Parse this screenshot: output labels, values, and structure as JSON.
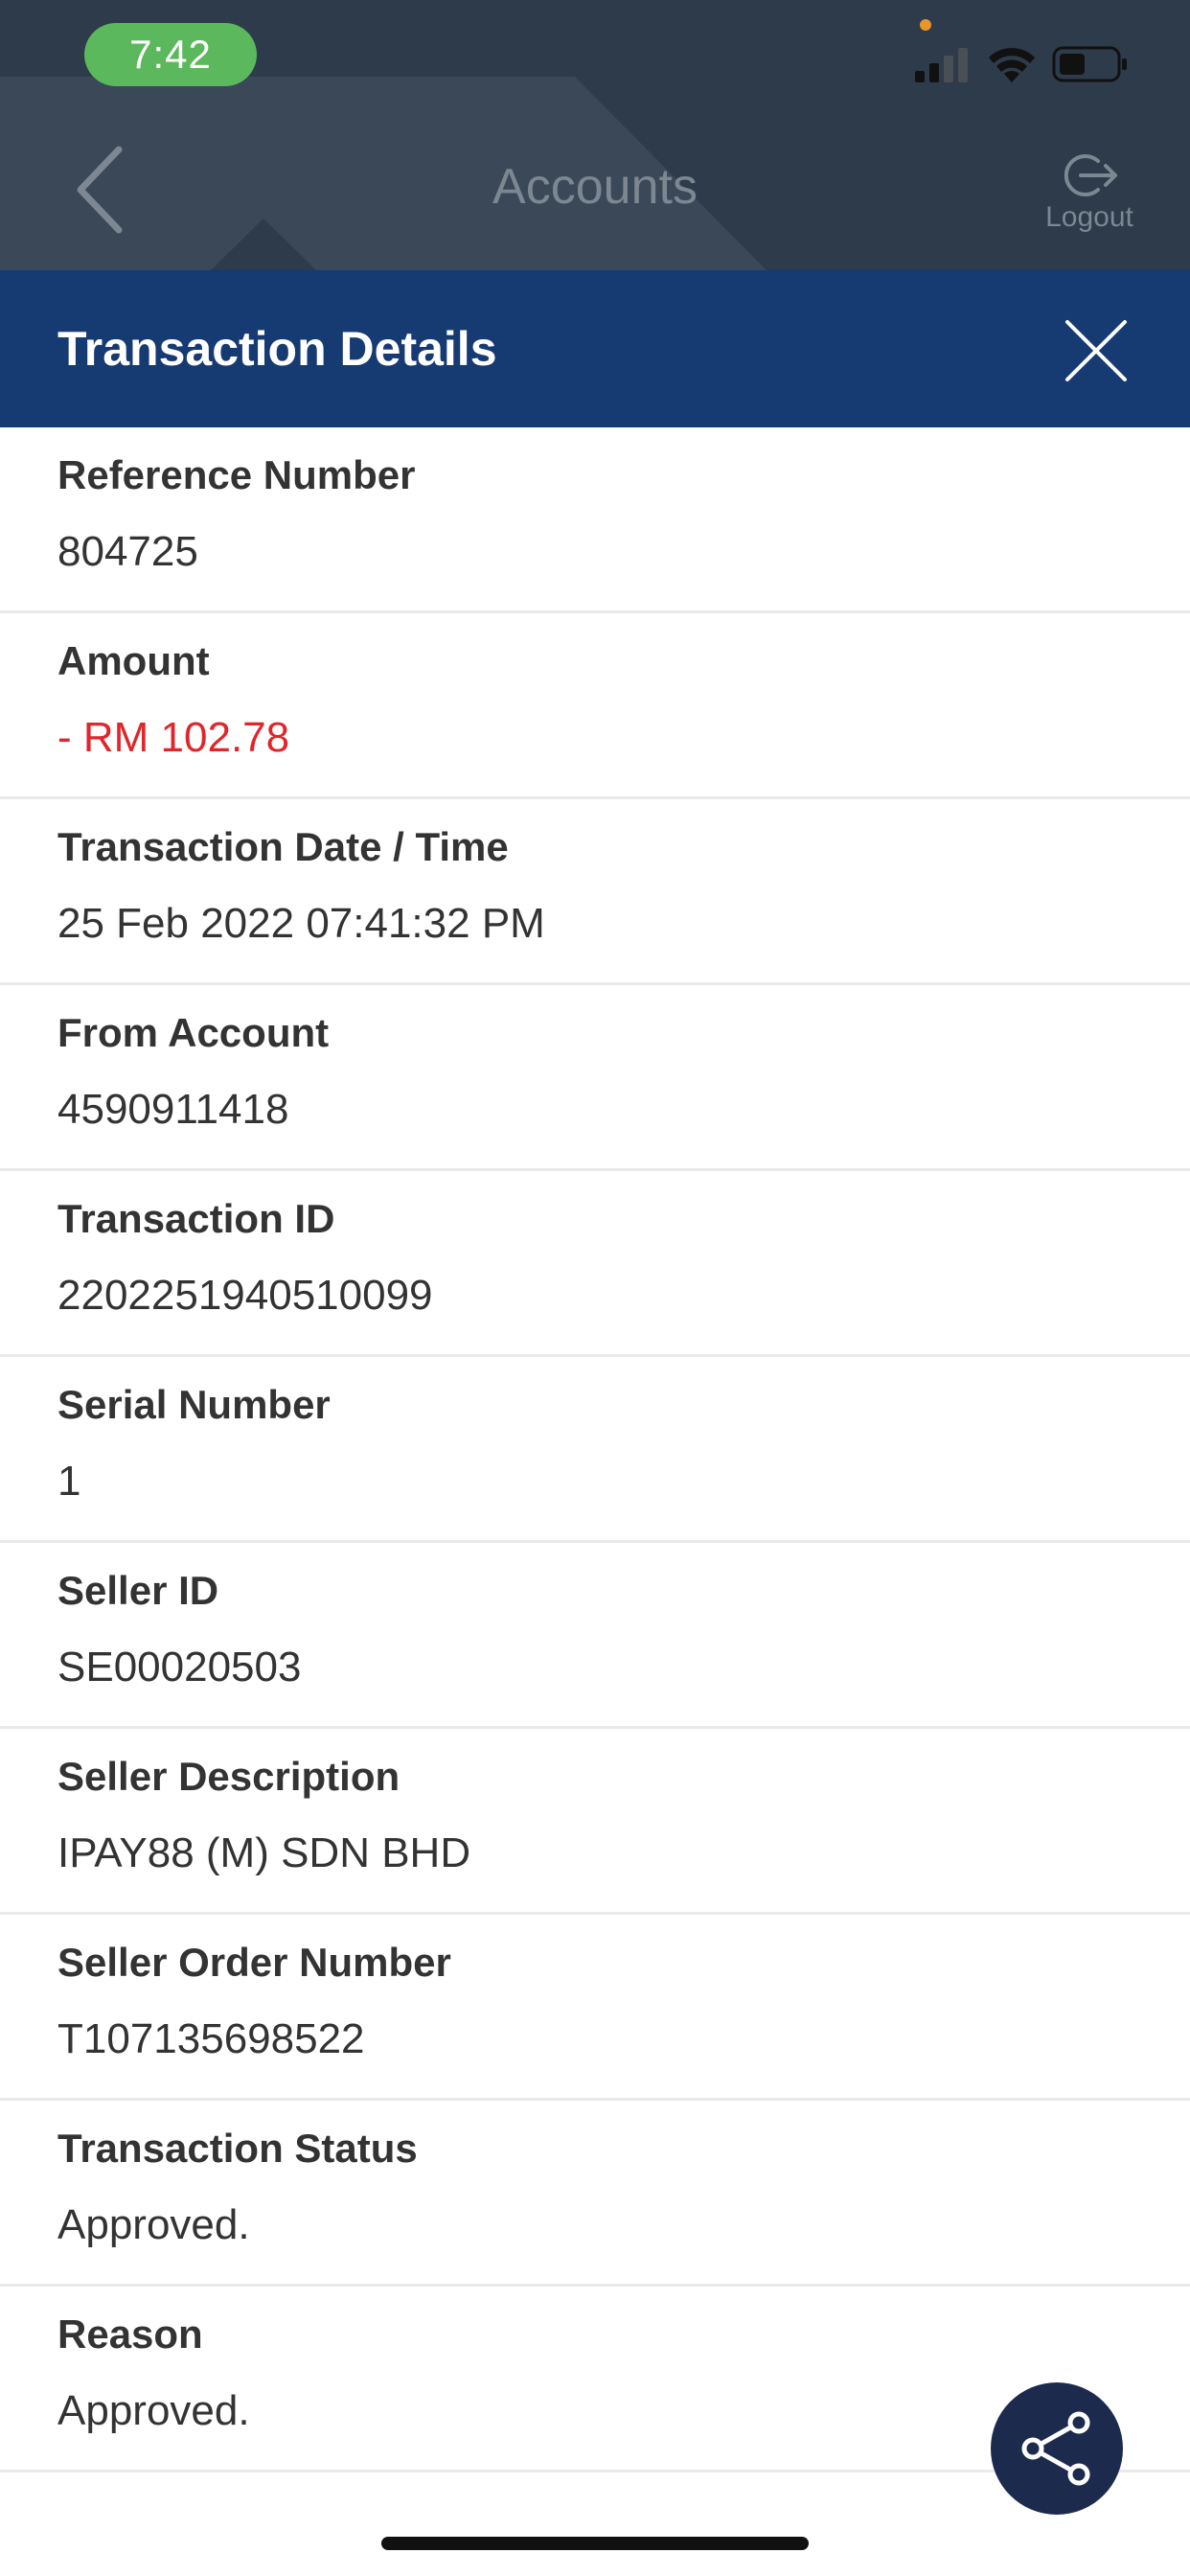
{
  "status_bar": {
    "time": "7:42"
  },
  "app_bar": {
    "title": "Accounts",
    "logout_label": "Logout"
  },
  "sheet": {
    "title": "Transaction Details",
    "rows": [
      {
        "label": "Reference Number",
        "value": "804725"
      },
      {
        "label": "Amount",
        "value": "- RM 102.78"
      },
      {
        "label": "Transaction Date / Time",
        "value": "25 Feb 2022 07:41:32 PM"
      },
      {
        "label": "From Account",
        "value": "4590911418"
      },
      {
        "label": "Transaction ID",
        "value": "2202251940510099"
      },
      {
        "label": "Serial Number",
        "value": "1"
      },
      {
        "label": "Seller ID",
        "value": "SE00020503"
      },
      {
        "label": "Seller Description",
        "value": "IPAY88 (M) SDN BHD"
      },
      {
        "label": "Seller Order Number",
        "value": "T107135698522"
      },
      {
        "label": "Transaction Status",
        "value": "Approved."
      },
      {
        "label": "Reason",
        "value": "Approved."
      }
    ]
  },
  "icons": {
    "back": "chevron-left-icon",
    "logout": "logout-icon",
    "close": "close-icon",
    "share": "share-icon",
    "signal": "cellular-signal-icon",
    "wifi": "wifi-icon",
    "battery": "battery-icon"
  },
  "colors": {
    "header_blue": "#163a72",
    "negative_amount": "#e0262b",
    "time_pill": "#5cb85c",
    "share_button": "#1c2b4d"
  }
}
